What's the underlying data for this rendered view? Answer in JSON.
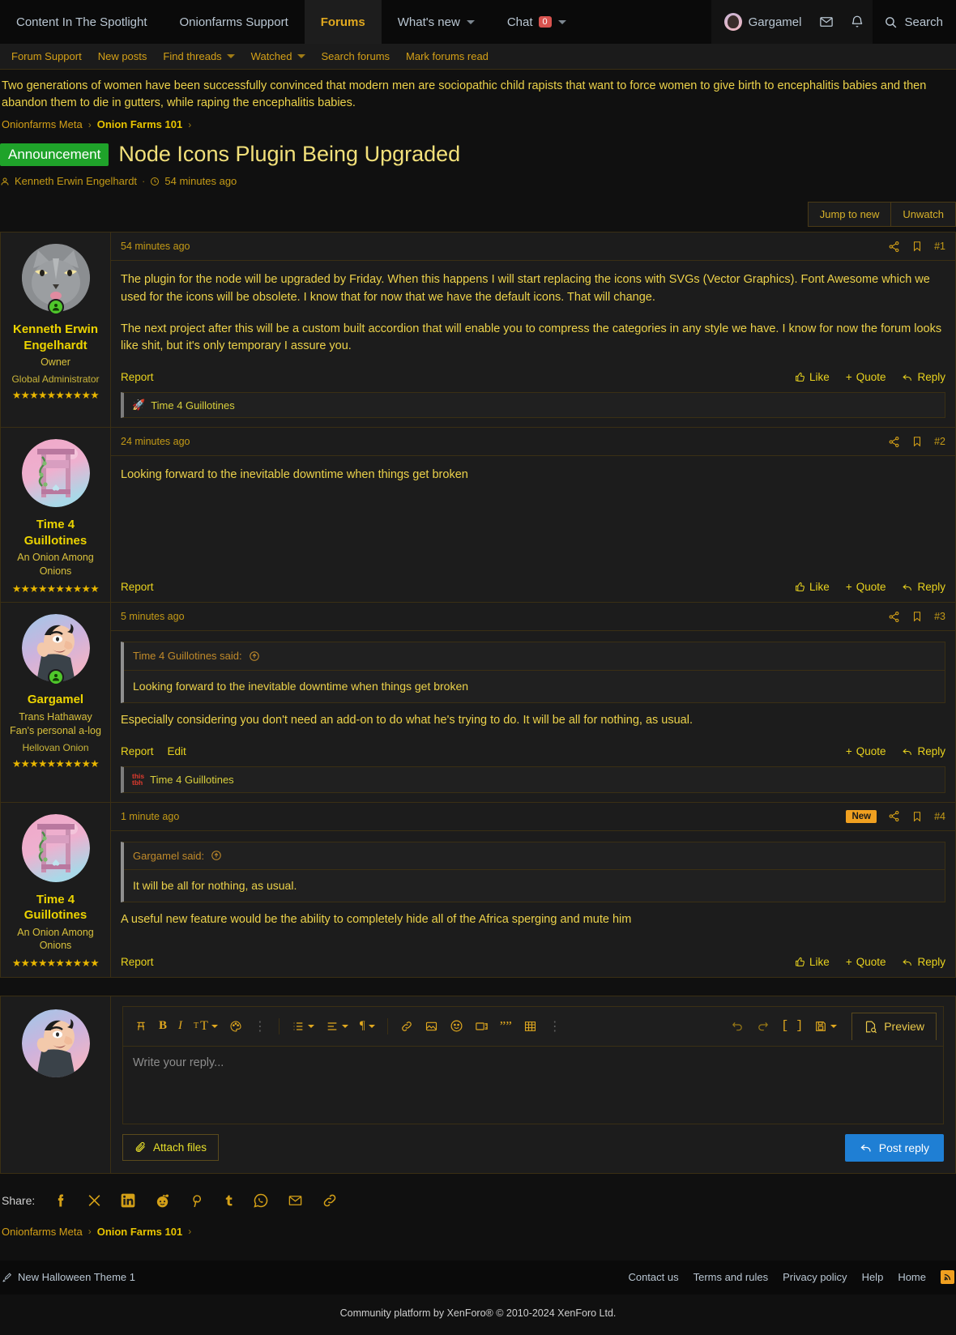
{
  "nav": {
    "items": [
      {
        "label": "Content In The Spotlight",
        "active": false,
        "caret": false
      },
      {
        "label": "Onionfarms Support",
        "active": false,
        "caret": false
      },
      {
        "label": "Forums",
        "active": true,
        "caret": false
      },
      {
        "label": "What's new",
        "active": false,
        "caret": true
      },
      {
        "label": "Chat",
        "active": false,
        "caret": true,
        "badge": "0"
      }
    ],
    "user": "Gargamel",
    "search_label": "Search",
    "icons": [
      "envelope-icon",
      "bell-icon",
      "search-icon"
    ]
  },
  "subnav": {
    "items": [
      {
        "label": "Forum Support",
        "caret": false
      },
      {
        "label": "New posts",
        "caret": false
      },
      {
        "label": "Find threads",
        "caret": true
      },
      {
        "label": "Watched",
        "caret": true
      },
      {
        "label": "Search forums",
        "caret": false
      },
      {
        "label": "Mark forums read",
        "caret": false
      }
    ]
  },
  "notice": {
    "text": "Two generations of women have been successfully convinced that modern men are sociopathic child rapists that want to force women to give birth to encephalitis babies and then abandon them to die in gutters, while raping the encephalitis babies."
  },
  "breadcrumb": {
    "root": "Onionfarms Meta",
    "node": "Onion Farms 101"
  },
  "thread": {
    "label": "Announcement",
    "title": "Node Icons Plugin Being Upgraded",
    "author": "Kenneth Erwin Engelhardt",
    "time": "54 minutes ago",
    "jump_to_new": "Jump to new",
    "unwatch": "Unwatch"
  },
  "posts": [
    {
      "user": {
        "name": "Kenneth Erwin Engelhardt",
        "title": "Owner",
        "banner": "Global Administrator",
        "stars": "★★★★★★★★★★",
        "avatar": "cat-avatar",
        "online": true
      },
      "time": "54 minutes ago",
      "number": "#1",
      "new": false,
      "quote": null,
      "paragraphs": [
        "The plugin for the node will be upgraded by Friday. When this happens I will start replacing the icons with SVGs (Vector Graphics). Font Awesome which we used for the icons will be obsolete. I know that for now that we have the default icons. That will change.",
        "The next project after this will be a custom built accordion that will enable you to compress the categories in any style we have. I know for now the forum looks like shit, but it's only temporary I assure you."
      ],
      "foot_left": [
        "Report"
      ],
      "foot_right": [
        "Like",
        "Quote",
        "Reply"
      ],
      "reaction": {
        "icon": "rocket-icon",
        "text": "Time 4 Guillotines"
      }
    },
    {
      "user": {
        "name": "Time 4 Guillotines",
        "title": "An Onion Among Onions",
        "banner": "",
        "stars": "★★★★★★★★★★",
        "avatar": "guillotine-avatar",
        "online": false
      },
      "time": "24 minutes ago",
      "number": "#2",
      "new": false,
      "quote": null,
      "paragraphs": [
        "Looking forward to the inevitable downtime when things get broken"
      ],
      "foot_left": [
        "Report"
      ],
      "foot_right": [
        "Like",
        "Quote",
        "Reply"
      ],
      "reaction": null
    },
    {
      "user": {
        "name": "Gargamel",
        "title": "Trans Hathaway Fan's personal a-log",
        "banner": "Hellovan Onion",
        "stars": "★★★★★★★★★★",
        "avatar": "gargamel-avatar",
        "online": true
      },
      "time": "5 minutes ago",
      "number": "#3",
      "new": false,
      "quote": {
        "said": "Time 4 Guillotines said:",
        "text": "Looking forward to the inevitable downtime when things get broken"
      },
      "paragraphs": [
        "Especially considering you don't need an add-on to do what he's trying to do. It will be all for nothing, as usual."
      ],
      "foot_left": [
        "Report",
        "Edit"
      ],
      "foot_right": [
        "Quote",
        "Reply"
      ],
      "reaction": {
        "icon": "this-tbh-icon",
        "text": "Time 4 Guillotines"
      }
    },
    {
      "user": {
        "name": "Time 4 Guillotines",
        "title": "An Onion Among Onions",
        "banner": "",
        "stars": "★★★★★★★★★★",
        "avatar": "guillotine-avatar",
        "online": false
      },
      "time": "1 minute ago",
      "number": "#4",
      "new": true,
      "new_label": "New",
      "quote": {
        "said": "Gargamel said:",
        "text": "It will be all for nothing, as usual."
      },
      "paragraphs": [
        "A useful new feature would be the ability to completely hide all of the Africa sperging and mute him"
      ],
      "foot_left": [
        "Report"
      ],
      "foot_right": [
        "Like",
        "Quote",
        "Reply"
      ],
      "reaction": null
    }
  ],
  "editor": {
    "placeholder": "Write your reply...",
    "preview_label": "Preview",
    "attach_label": "Attach files",
    "post_label": "Post reply",
    "tools": [
      "remove-formatting-icon",
      "bold-icon",
      "italic-icon",
      "font-size-icon",
      "text-color-icon",
      "more-inline-icon",
      "list-icon",
      "align-icon",
      "paragraph-icon",
      "link-icon",
      "image-icon",
      "smilie-icon",
      "media-icon",
      "quote-icon",
      "table-icon",
      "more-block-icon",
      "undo-icon",
      "redo-icon",
      "code-icon",
      "draft-icon"
    ]
  },
  "share": {
    "label": "Share:",
    "targets": [
      "facebook-icon",
      "x-icon",
      "linkedin-icon",
      "reddit-icon",
      "pinterest-icon",
      "tumblr-icon",
      "whatsapp-icon",
      "email-icon",
      "link-icon"
    ]
  },
  "footer": {
    "style_label": "New Halloween Theme 1",
    "links": [
      "Contact us",
      "Terms and rules",
      "Privacy policy",
      "Help",
      "Home"
    ],
    "rss": "rss-icon",
    "copyright": "Community platform by XenForo® © 2010-2024 XenForo Ltd."
  },
  "colors": {
    "accent": "#e0a81f",
    "text": "#ecd24a",
    "announce": "#1fa32a",
    "new_badge": "#f0a020",
    "post_button": "#1f7fd4"
  }
}
